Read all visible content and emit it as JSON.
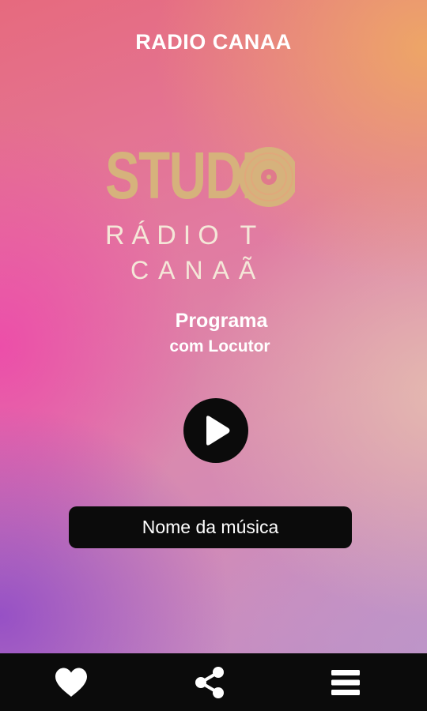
{
  "header": {
    "title": "RADIO CANAA"
  },
  "logo": {
    "line1": "STUDIO",
    "line2": "RÁDIO T",
    "line3": "CANAÃ",
    "color_gold": "#d6b27c",
    "color_cream": "#f4e7d8"
  },
  "now_playing": {
    "program": "Programa",
    "host": "com Locutor",
    "song": "Nome da música"
  },
  "controls": {
    "play_icon": "play-icon"
  },
  "bottom_nav": {
    "items": [
      {
        "icon": "heart-icon"
      },
      {
        "icon": "share-icon"
      },
      {
        "icon": "menu-icon"
      }
    ]
  },
  "colors": {
    "bar_background": "#0b0b0b",
    "text": "#ffffff"
  }
}
